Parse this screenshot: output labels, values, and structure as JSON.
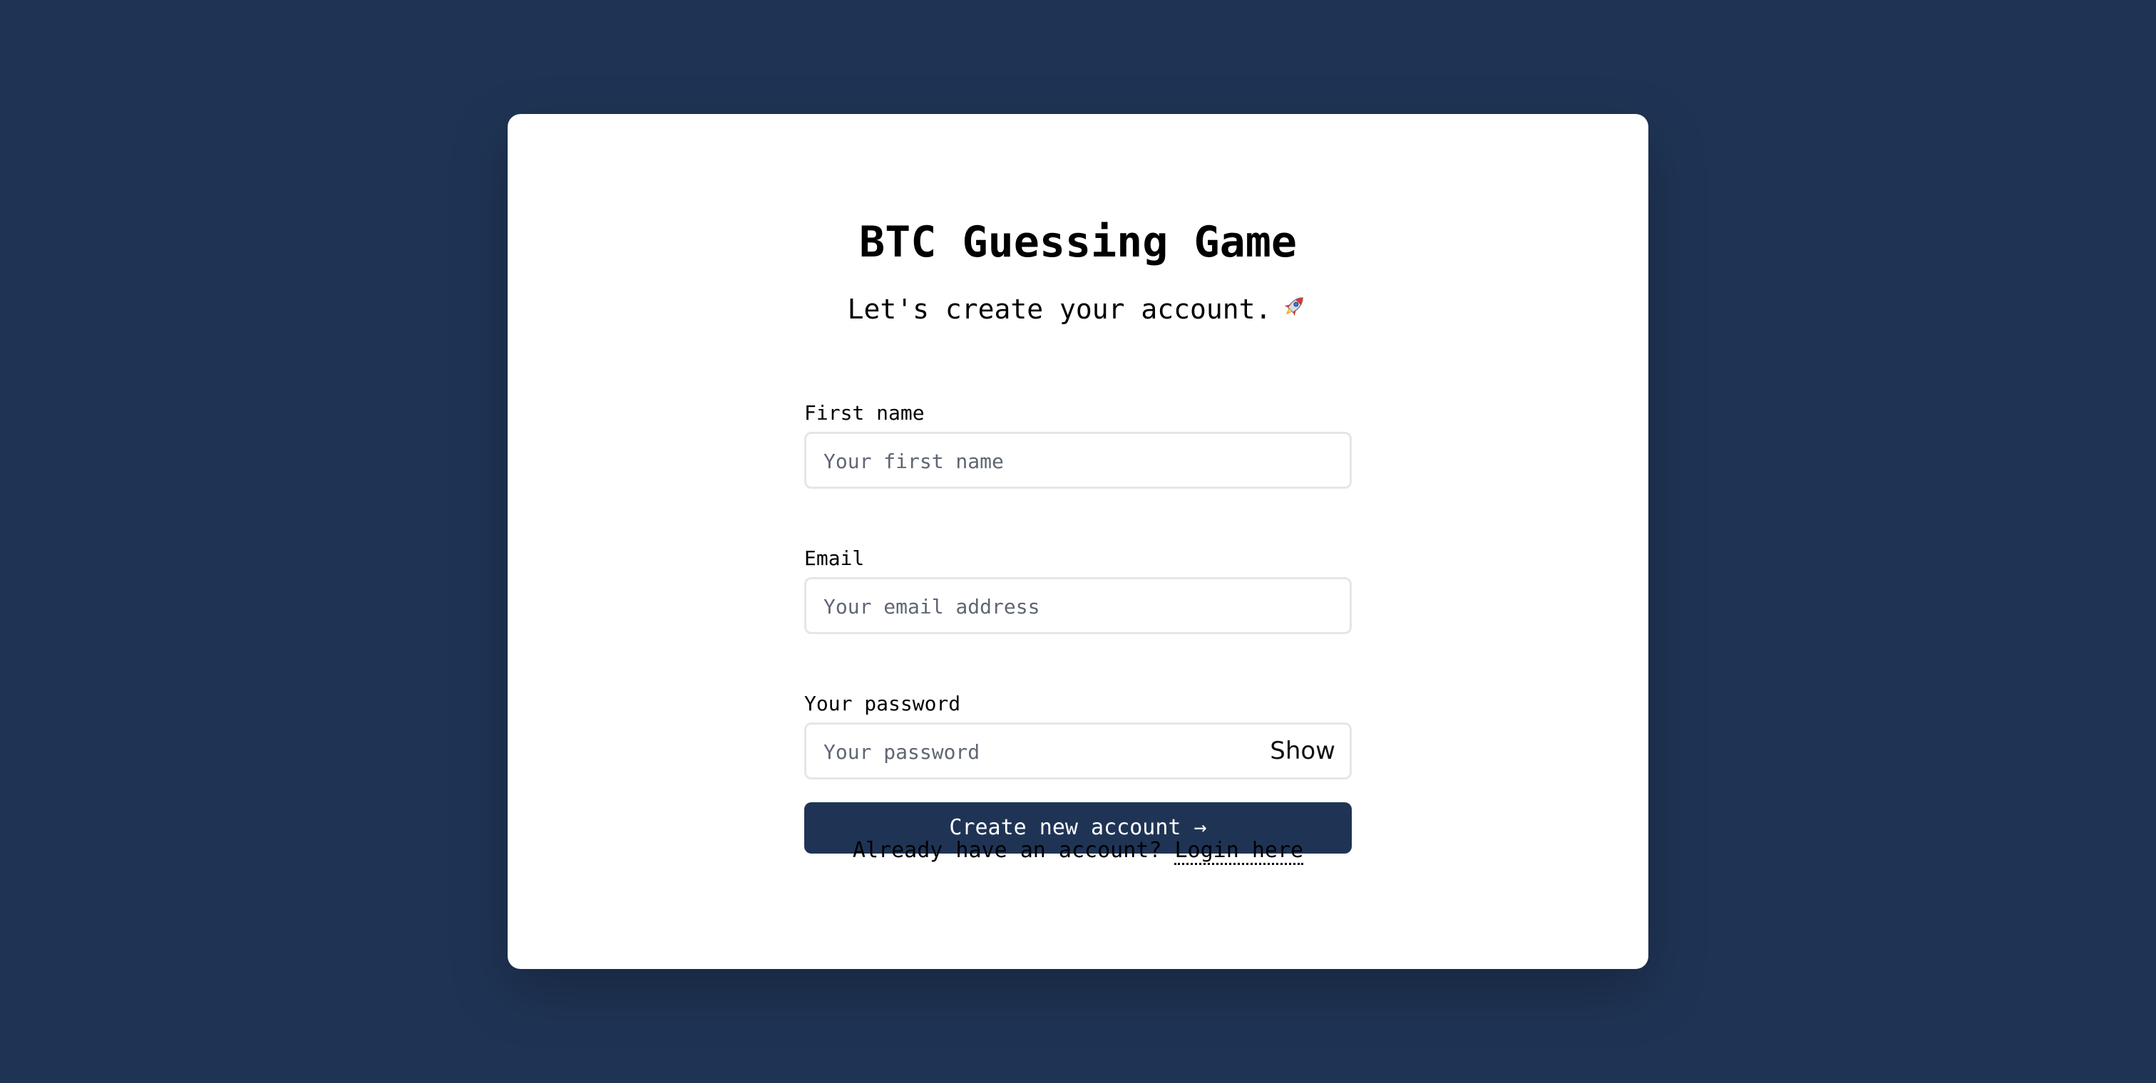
{
  "header": {
    "title": "BTC Guessing Game",
    "subtitle": "Let's create your account.",
    "subtitle_icon": "rocket-icon"
  },
  "form": {
    "first_name": {
      "label": "First name",
      "placeholder": "Your first name",
      "value": ""
    },
    "email": {
      "label": "Email",
      "placeholder": "Your email address",
      "value": ""
    },
    "password": {
      "label": "Your password",
      "placeholder": "Your password",
      "value": "",
      "toggle_label": "Show"
    },
    "submit_label": "Create new account →"
  },
  "footer": {
    "prompt": "Already have an account?",
    "link_label": "Login here"
  },
  "colors": {
    "background": "#1f3455",
    "card": "#ffffff",
    "button": "#1f3455",
    "button_text": "#ffffff"
  }
}
